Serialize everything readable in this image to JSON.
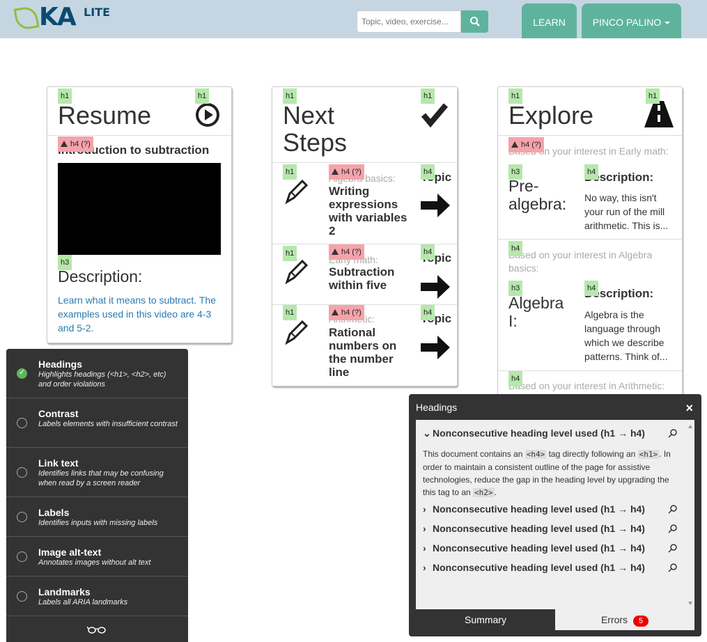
{
  "header": {
    "logo_text": "KA",
    "logo_sub": "LITE",
    "search_placeholder": "Topic, video, exercise...",
    "learn_label": "LEARN",
    "user_label": "PINCO PALINO"
  },
  "resume": {
    "title": "Resume",
    "h1_tag_left": "h1",
    "h1_tag_right": "h1",
    "err_tag": "h4 (?)",
    "video_title": "Introduction to subtraction",
    "h3_tag": "h3",
    "desc_label": "Description:",
    "desc_text": "Learn what it means to subtract. The examples used in this video are 4-3 and 5-2."
  },
  "next": {
    "title_line1": "Next",
    "title_line2": "Steps",
    "h1_tag_left": "h1",
    "h1_tag_right": "h1",
    "rows": [
      {
        "h1": "h1",
        "err": "h4 (?)",
        "h4": "h4",
        "sub": "Algebra basics:",
        "title": "Writing expressions with variables 2",
        "topic": "Topic"
      },
      {
        "h1": "h1",
        "err": "h4 (?)",
        "h4": "h4",
        "sub": "Early math:",
        "title": "Subtraction within five",
        "topic": "Topic"
      },
      {
        "h1": "h1",
        "err": "h4 (?)",
        "h4": "h4",
        "sub": "Arithmetic:",
        "title": "Rational numbers on the number line",
        "topic": "Topic"
      }
    ]
  },
  "explore": {
    "title": "Explore",
    "h1_tag_left": "h1",
    "h1_tag_right": "h1",
    "rows": [
      {
        "tag": "h4 (?)",
        "interest": "Based on your interest in Early math:",
        "h3": "h3",
        "h4": "h4",
        "name": "Pre-algebra:",
        "desc_label": "Description:",
        "desc": "No way, this isn't your run of the mill arithmetic. This is..."
      },
      {
        "tag": "h4",
        "interest": "Based on your interest in Algebra basics:",
        "h3": "h3",
        "h4": "h4",
        "name": "Algebra I:",
        "desc_label": "Description:",
        "desc": "Algebra is the language through which we describe patterns. Think of..."
      },
      {
        "tag": "h4",
        "interest": "Based on your interest in Arithmetic:"
      }
    ]
  },
  "tota11y": {
    "items": [
      {
        "name": "Headings",
        "desc": "Highlights headings (<h1>, <h2>, etc) and order violations",
        "active": true
      },
      {
        "name": "Contrast",
        "desc": "Labels elements with insufficient contrast",
        "active": false
      },
      {
        "name": "Link text",
        "desc": "Identifies links that may be confusing when read by a screen reader",
        "active": false
      },
      {
        "name": "Labels",
        "desc": "Identifies inputs with missing labels",
        "active": false
      },
      {
        "name": "Image alt-text",
        "desc": "Annotates images without alt text",
        "active": false
      },
      {
        "name": "Landmarks",
        "desc": "Labels all ARIA landmarks",
        "active": false
      }
    ]
  },
  "headings_panel": {
    "title": "Headings",
    "close": "×",
    "issue_label": "Nonconsecutive heading level used (h1 → h4)",
    "explain_1": "This document contains an ",
    "explain_code1": "<h4>",
    "explain_2": " tag directly following an ",
    "explain_code2": "<h1>",
    "explain_3": ". In order to maintain a consistent outline of the page for assistive technologies, reduce the gap in the heading level by upgrading the this tag to an ",
    "explain_code3": "<h2>",
    "explain_4": ".",
    "tab_summary": "Summary",
    "tab_errors": "Errors",
    "error_count": "5"
  }
}
